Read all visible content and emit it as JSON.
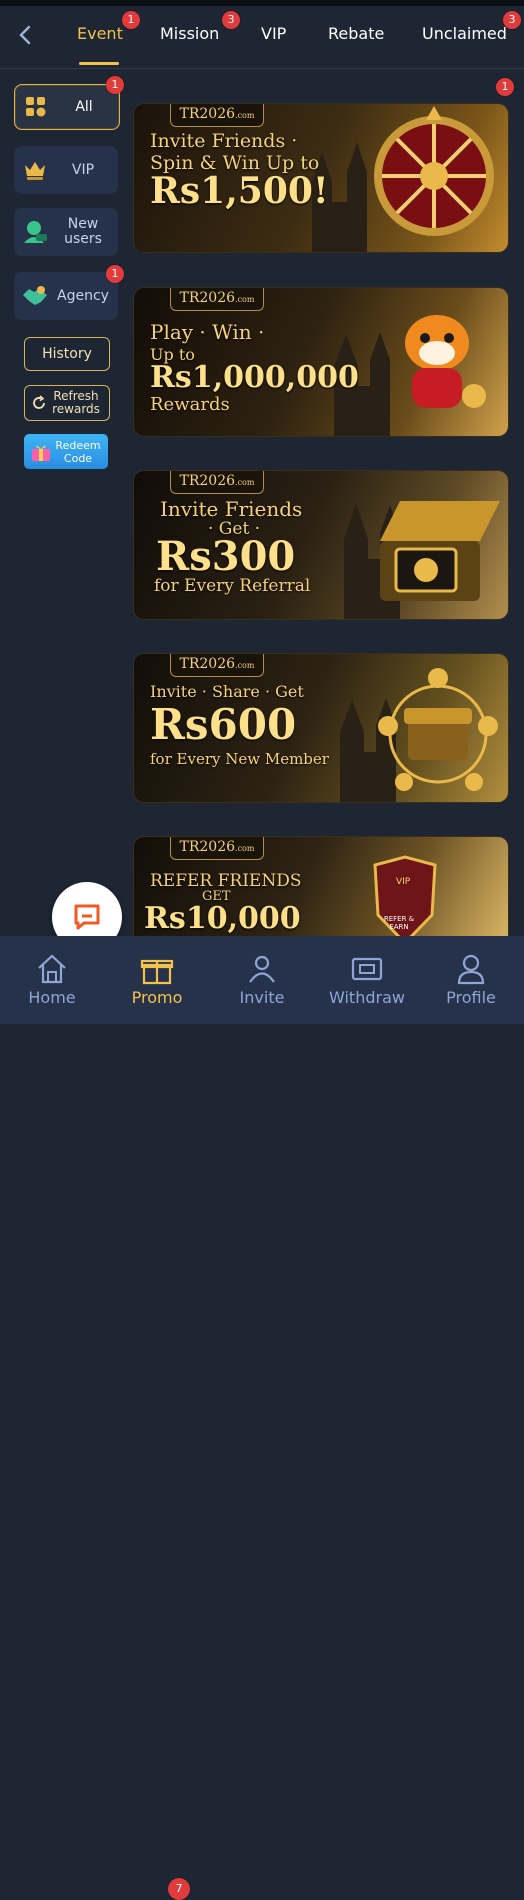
{
  "tabs": [
    {
      "label": "Event",
      "badge": "1",
      "active": true
    },
    {
      "label": "Mission",
      "badge": "3"
    },
    {
      "label": "VIP"
    },
    {
      "label": "Rebate"
    },
    {
      "label": "Unclaimed",
      "badge": "3"
    }
  ],
  "sidebar": {
    "items": [
      {
        "label": "All",
        "badge": "1",
        "icon": "grid-icon"
      },
      {
        "label": "VIP",
        "icon": "crown-icon"
      },
      {
        "label": "New users",
        "icon": "new-user-icon"
      },
      {
        "label": "Agency",
        "badge": "1",
        "icon": "handshake-icon"
      }
    ],
    "history_label": "History",
    "refresh_label": "Refresh rewards",
    "redeem_label": "Redeem Code"
  },
  "banners": [
    {
      "logo": "TR2026",
      "logo_suffix": ".com",
      "line1": "Invite Friends ·",
      "line2": "Spin & Win Up to",
      "amount": "Rs1,500!",
      "line3": "",
      "badge": "1"
    },
    {
      "logo": "TR2026",
      "logo_suffix": ".com",
      "line1": "Play · Win ·",
      "line2": "Up to",
      "amount": "Rs1,000,000",
      "line3": "Rewards"
    },
    {
      "logo": "TR2026",
      "logo_suffix": ".com",
      "line1": "Invite Friends",
      "line2": "· Get ·",
      "amount": "Rs300",
      "line3": "for Every Referral"
    },
    {
      "logo": "TR2026",
      "logo_suffix": ".com",
      "line1": "Invite · Share · Get",
      "line2": "",
      "amount": "Rs600",
      "line3": "for Every New Member"
    },
    {
      "logo": "TR2026",
      "logo_suffix": ".com",
      "line1": "REFER FRIENDS",
      "line2": "GET",
      "amount": "Rs10,000",
      "line3": "",
      "shield_top": "VIP",
      "shield_bottom": "REFER & EARN"
    }
  ],
  "bottom_nav": [
    {
      "label": "Home",
      "icon": "home-icon"
    },
    {
      "label": "Promo",
      "icon": "gift-icon",
      "badge": "7",
      "active": true
    },
    {
      "label": "Invite",
      "icon": "invite-icon"
    },
    {
      "label": "Withdraw",
      "icon": "withdraw-icon"
    },
    {
      "label": "Profile",
      "icon": "profile-icon"
    }
  ],
  "colors": {
    "accent": "#f2c14e",
    "background": "#1e2634",
    "badge": "#e13b3b",
    "nav_inactive": "#8ea6d6"
  }
}
